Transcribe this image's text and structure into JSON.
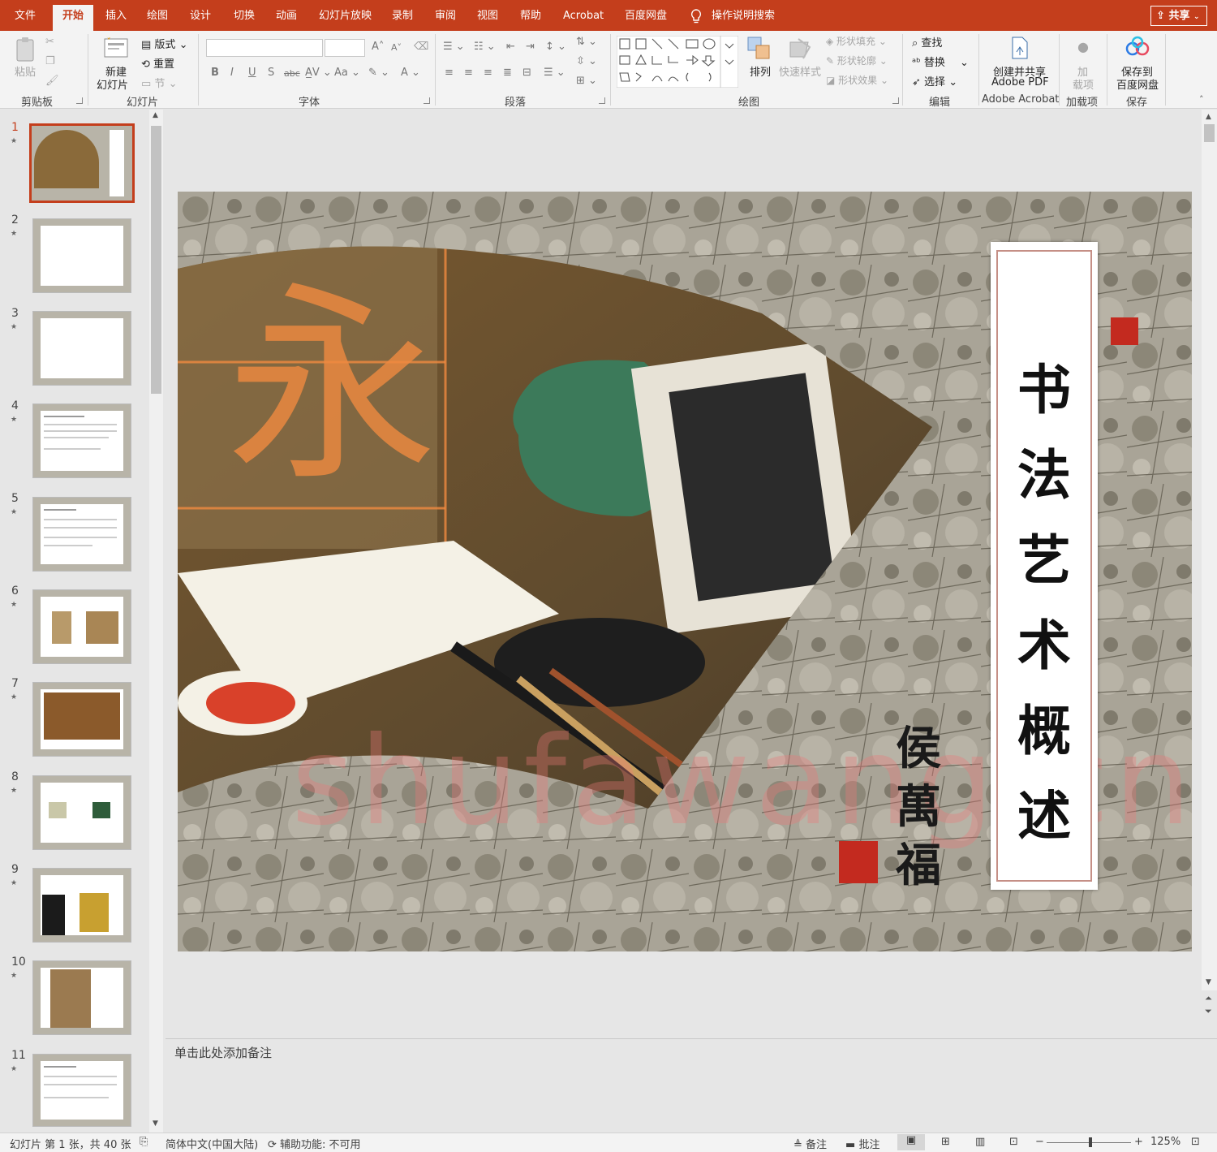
{
  "tabs": [
    "文件",
    "开始",
    "插入",
    "绘图",
    "设计",
    "切换",
    "动画",
    "幻灯片放映",
    "录制",
    "审阅",
    "视图",
    "帮助",
    "Acrobat",
    "百度网盘"
  ],
  "active_tab": "开始",
  "tell_me": "操作说明搜索",
  "share": "共享",
  "ribbon": {
    "clipboard": {
      "paste": "粘贴",
      "label": "剪贴板"
    },
    "slides": {
      "new_slide_1": "新建",
      "new_slide_2": "幻灯片",
      "layout": "版式",
      "reset": "重置",
      "section": "节",
      "label": "幻灯片"
    },
    "font": {
      "label": "字体"
    },
    "paragraph": {
      "label": "段落"
    },
    "drawing": {
      "arrange": "排列",
      "quick_styles": "快速样式",
      "shape_fill": "形状填充",
      "shape_outline": "形状轮廓",
      "shape_effects": "形状效果",
      "label": "绘图"
    },
    "editing": {
      "find": "查找",
      "replace": "替换",
      "select": "选择",
      "label": "编辑"
    },
    "acrobat": {
      "line1": "创建并共享",
      "line2": "Adobe PDF",
      "label": "Adobe Acrobat"
    },
    "addins": {
      "line1": "加",
      "line2": "载项",
      "label": "加载项"
    },
    "save": {
      "line1": "保存到",
      "line2": "百度网盘",
      "label": "保存"
    }
  },
  "thumbnails": [
    {
      "num": "1",
      "kind": "title"
    },
    {
      "num": "2",
      "kind": "blank"
    },
    {
      "num": "3",
      "kind": "blank"
    },
    {
      "num": "4",
      "kind": "text"
    },
    {
      "num": "5",
      "kind": "text"
    },
    {
      "num": "6",
      "kind": "images"
    },
    {
      "num": "7",
      "kind": "full-image"
    },
    {
      "num": "8",
      "kind": "images"
    },
    {
      "num": "9",
      "kind": "images"
    },
    {
      "num": "10",
      "kind": "image-left"
    },
    {
      "num": "11",
      "kind": "text"
    }
  ],
  "slide": {
    "title_vertical": "书法艺术概述",
    "signature": "侯萬福",
    "watermark": "shufawang.cn"
  },
  "notes_placeholder": "单击此处添加备注",
  "status": {
    "slide_info": "幻灯片 第 1 张，共 40 张",
    "language": "简体中文(中国大陆)",
    "accessibility": "辅助功能: 不可用",
    "notes_btn": "备注",
    "comments_btn": "批注",
    "zoom": "125%"
  },
  "colors": {
    "accent": "#c43e1c",
    "ribbon_bg": "#f3f3f3",
    "pane_bg": "#e6e6e6"
  }
}
